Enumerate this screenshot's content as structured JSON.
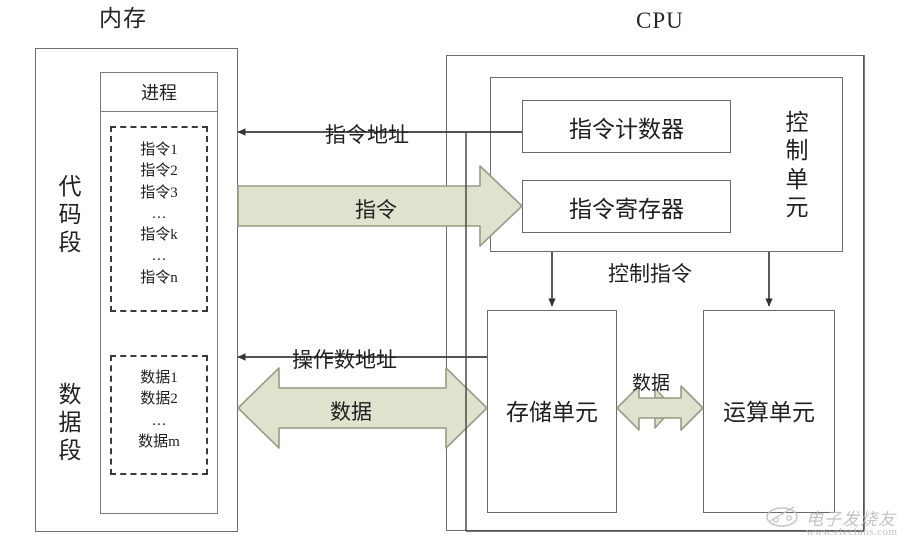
{
  "diagram": {
    "memory_title": "内存",
    "cpu_title": "CPU",
    "memory": {
      "segments": [
        {
          "label": "代码段",
          "chars": [
            "代",
            "码",
            "段"
          ]
        },
        {
          "label": "数据段",
          "chars": [
            "数",
            "据",
            "段"
          ]
        }
      ],
      "process_header": "进程",
      "code_items": [
        "指令1",
        "指令2",
        "指令3",
        "…",
        "指令k",
        "…",
        "指令n"
      ],
      "data_items": [
        "数据1",
        "数据2",
        "…",
        "数据m"
      ]
    },
    "cpu": {
      "control_unit_label": "控制单元",
      "control_unit_chars": [
        "控",
        "制",
        "单",
        "元"
      ],
      "blocks": [
        {
          "name": "instruction-counter",
          "label": "指令计数器"
        },
        {
          "name": "instruction-register",
          "label": "指令寄存器"
        },
        {
          "name": "storage-unit",
          "label": "存储单元"
        },
        {
          "name": "arithmetic-unit",
          "label": "运算单元"
        }
      ]
    },
    "connectors": [
      {
        "name": "instruction-address",
        "label": "指令地址"
      },
      {
        "name": "instruction-bus",
        "label": "指令"
      },
      {
        "name": "control-instruction",
        "label": "控制指令"
      },
      {
        "name": "operand-address",
        "label": "操作数地址"
      },
      {
        "name": "data-bus-memory",
        "label": "数据"
      },
      {
        "name": "data-bus-internal",
        "label": "数据"
      }
    ],
    "watermark": {
      "brand": "电子发烧友",
      "site": "www.elecfans.com"
    },
    "colors": {
      "arrow_fill": "#dfe2cd",
      "arrow_stroke": "#9a9a86",
      "line": "#4a4a4a",
      "box_border": "#6e6e6e",
      "text": "#1f1f1f"
    }
  }
}
